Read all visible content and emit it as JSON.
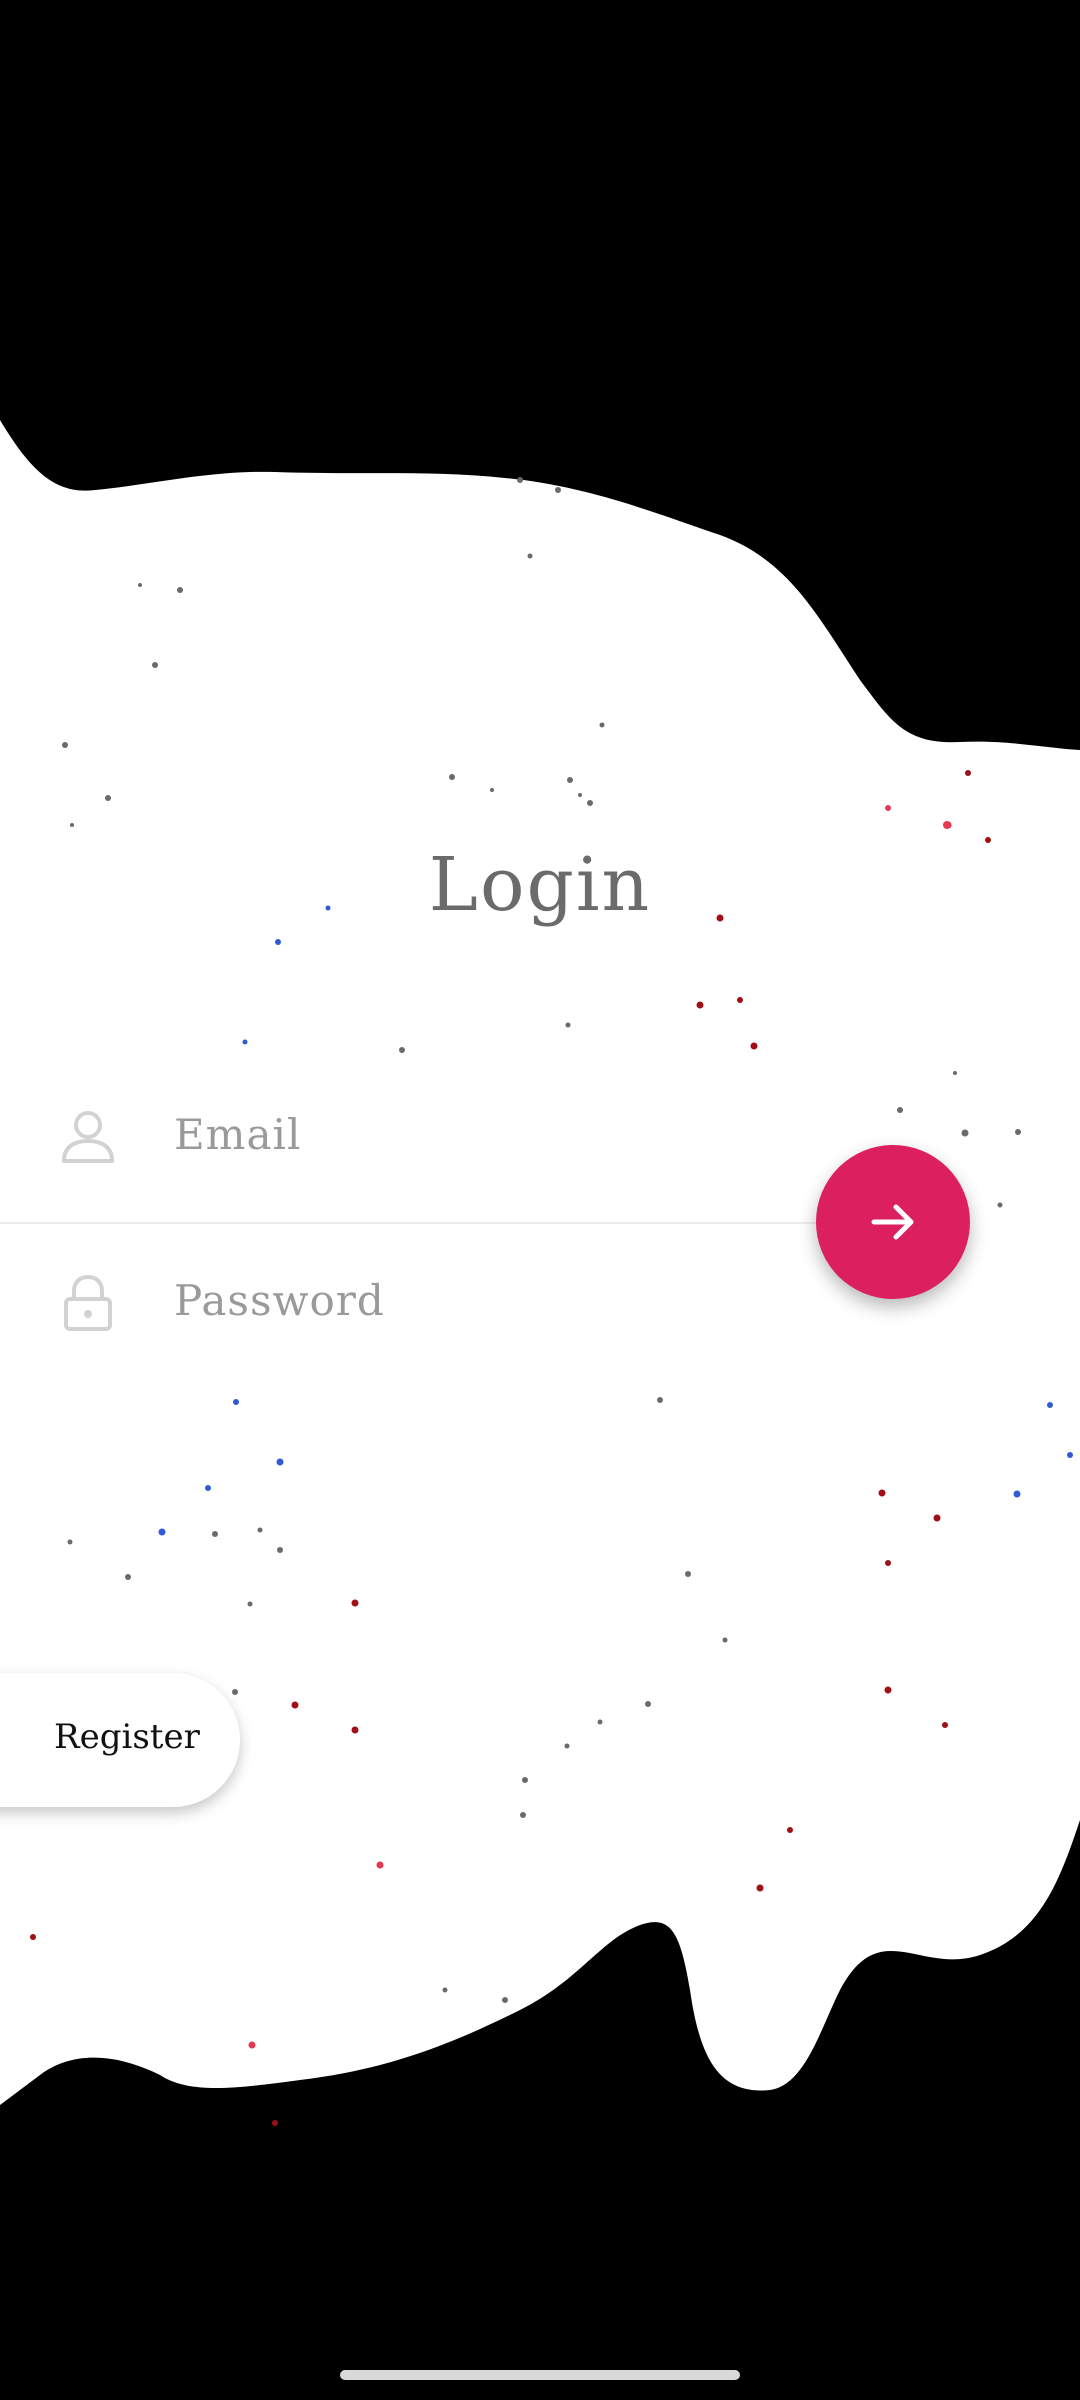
{
  "header": {
    "title": "Login"
  },
  "form": {
    "email_placeholder": "Email",
    "password_placeholder": "Password",
    "submit_icon": "arrow-right-icon"
  },
  "register": {
    "label": "Register"
  },
  "colors": {
    "accent": "#dc1f5f",
    "background_dark": "#000000",
    "surface": "#ffffff",
    "placeholder": "#9a9a9a",
    "title": "#6b6b6b"
  },
  "icons": {
    "email": "person-icon",
    "password": "lock-icon",
    "submit": "arrow-right-icon"
  }
}
